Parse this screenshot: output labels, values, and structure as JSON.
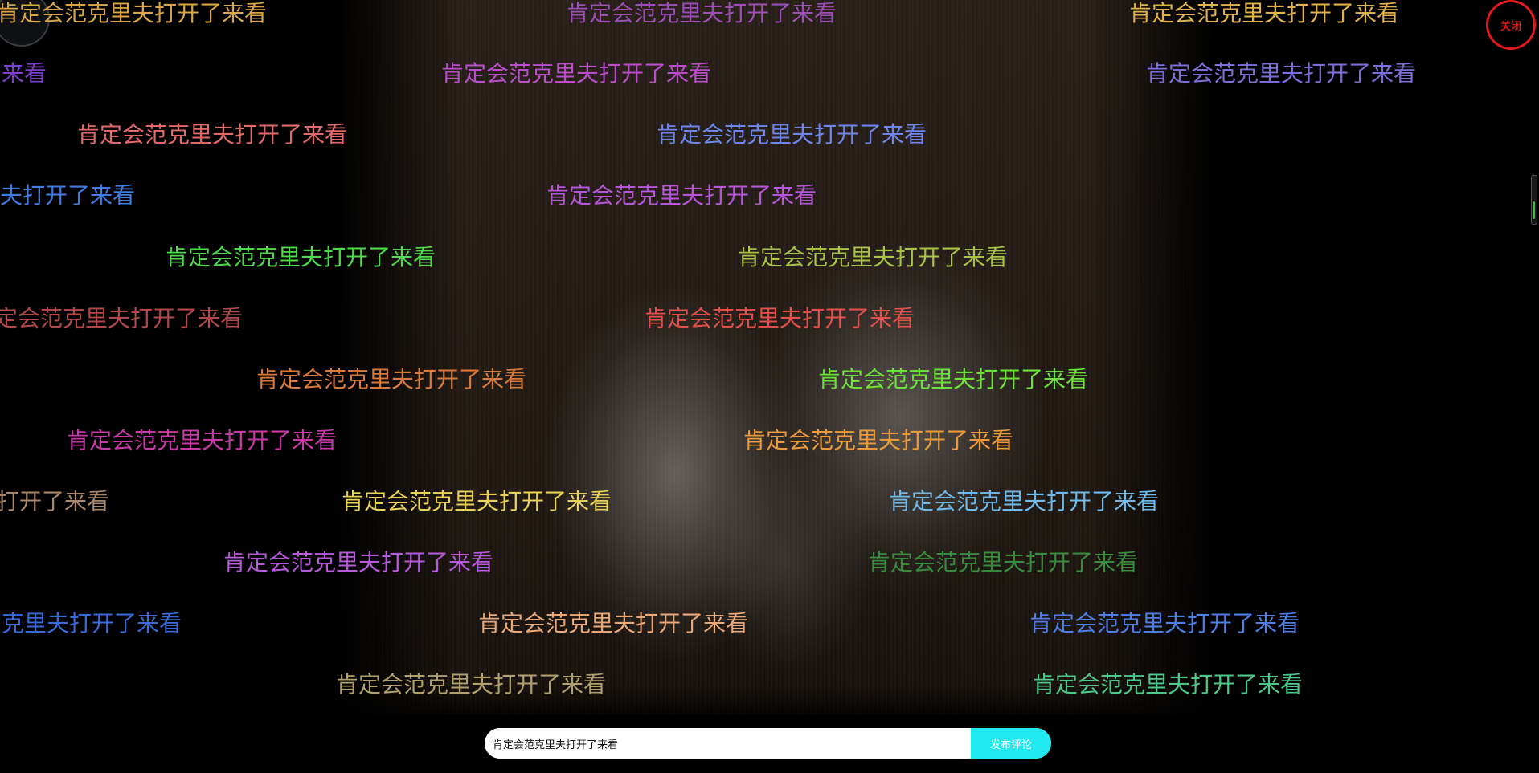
{
  "close_button": {
    "label": "关闭",
    "color": "#e01a1a"
  },
  "composer": {
    "input_value": "肯定会范克里夫打开了来看",
    "button_label": "发布评论",
    "button_color": "#22e8ef"
  },
  "danmaku": [
    {
      "text": "肯定会范克里夫打开了来看",
      "color": "#d9a64a"
    },
    {
      "text": "肯定会范克里夫打开了来看",
      "color": "#9b4fb5"
    },
    {
      "text": "肯定会范克里夫打开了来看",
      "color": "#e0b24e"
    },
    {
      "text": "来看",
      "color": "#7a3fc4"
    },
    {
      "text": "肯定会范克里夫打开了来看",
      "color": "#b84fc8"
    },
    {
      "text": "肯定会范克里夫打开了来看",
      "color": "#7b6fd6"
    },
    {
      "text": "肯定会范克里夫打开了来看",
      "color": "#e06a6a"
    },
    {
      "text": "肯定会范克里夫打开了来看",
      "color": "#6f86e8"
    },
    {
      "text": "夫打开了来看",
      "color": "#3f7be0"
    },
    {
      "text": "肯定会范克里夫打开了来看",
      "color": "#b556d4"
    },
    {
      "text": "肯定会范克里夫打开了来看",
      "color": "#52d84e"
    },
    {
      "text": "肯定会范克里夫打开了来看",
      "color": "#a8c24a"
    },
    {
      "text": "定会范克里夫打开了来看",
      "color": "#b04a4a"
    },
    {
      "text": "肯定会范克里夫打开了来看",
      "color": "#e0504a"
    },
    {
      "text": "肯定会范克里夫打开了来看",
      "color": "#d87a3e"
    },
    {
      "text": "肯定会范克里夫打开了来看",
      "color": "#6ee03c"
    },
    {
      "text": "肯定会范克里夫打开了来看",
      "color": "#c63aa6"
    },
    {
      "text": "肯定会范克里夫打开了来看",
      "color": "#e89a3c"
    },
    {
      "text": "打开了来看",
      "color": "#a8876a"
    },
    {
      "text": "肯定会范克里夫打开了来看",
      "color": "#e8d25a"
    },
    {
      "text": "肯定会范克里夫打开了来看",
      "color": "#6fb8e8"
    },
    {
      "text": "肯定会范克里夫打开了来看",
      "color": "#b55ad8"
    },
    {
      "text": "肯定会范克里夫打开了来看",
      "color": "#3a8a3e"
    },
    {
      "text": "克里夫打开了来看",
      "color": "#3a6ad8"
    },
    {
      "text": "肯定会范克里夫打开了来看",
      "color": "#e8a87a"
    },
    {
      "text": "肯定会范克里夫打开了来看",
      "color": "#4e7ee0"
    },
    {
      "text": "肯定会范克里夫打开了来看",
      "color": "#b0a070"
    },
    {
      "text": "肯定会范克里夫打开了来看",
      "color": "#4ec88a"
    }
  ]
}
